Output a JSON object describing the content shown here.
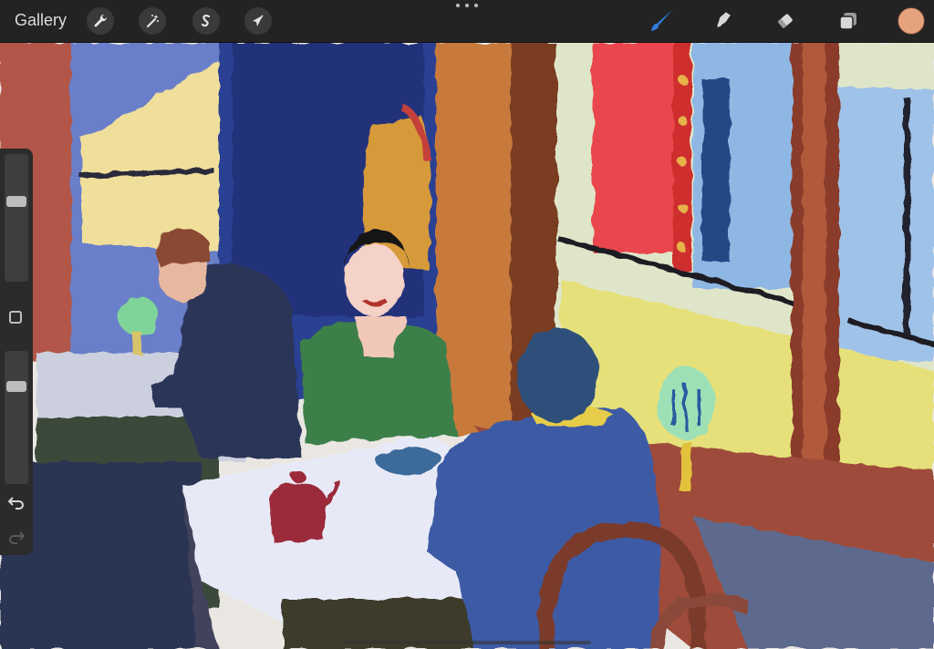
{
  "topbar": {
    "gallery_label": "Gallery",
    "left_tools": [
      {
        "icon": "wrench-icon"
      },
      {
        "icon": "magic-wand-icon"
      },
      {
        "icon": "selection-s-icon"
      },
      {
        "icon": "arrow-cursor-icon"
      }
    ],
    "right_tools": [
      {
        "icon": "brush-icon",
        "active": true
      },
      {
        "icon": "smudge-icon"
      },
      {
        "icon": "eraser-icon"
      },
      {
        "icon": "layers-icon"
      }
    ],
    "current_color": "#e6a27c",
    "accent_color": "#2f7fe0"
  },
  "sidebar": {
    "brush_size_level": 0.63,
    "opacity_level": 0.75
  },
  "canvas": {
    "artwork": "painting"
  }
}
